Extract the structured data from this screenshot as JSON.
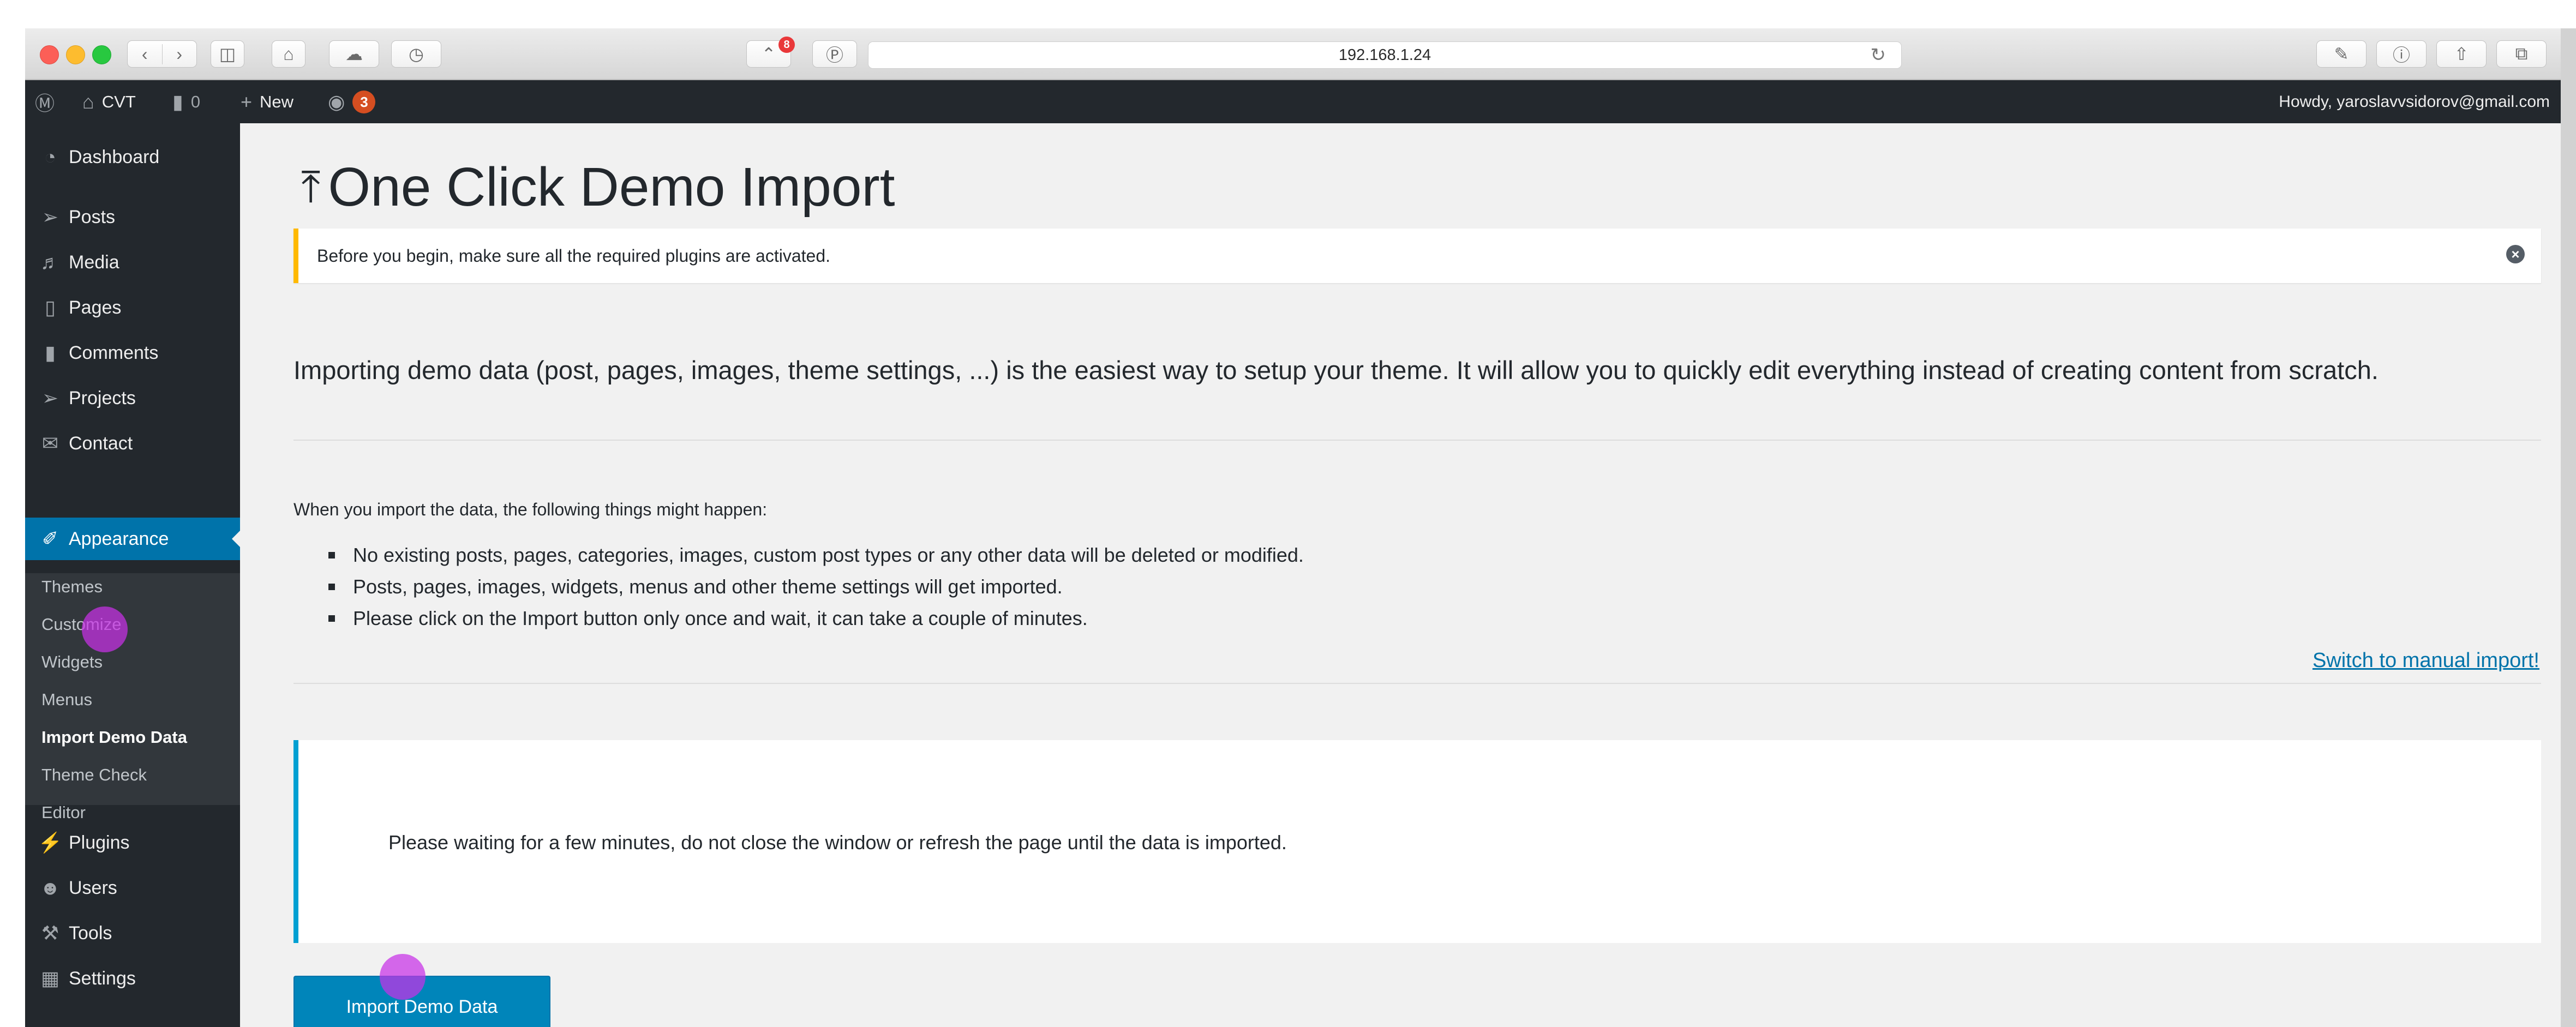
{
  "browser": {
    "url": "192.168.1.24",
    "extension_badge_count": "8"
  },
  "adminbar": {
    "wp_logo_icon": "wordpress-icon",
    "site_name": "CVT",
    "comments_count": "0",
    "new_label": "New",
    "yoast_count": "3",
    "howdy": "Howdy, yaroslavvsidorov@gmail.com"
  },
  "sidebar": {
    "items": [
      {
        "label": "Dashboard",
        "icon": "dashboard-icon"
      },
      {
        "label": "Posts",
        "icon": "pin-icon"
      },
      {
        "label": "Media",
        "icon": "media-icon"
      },
      {
        "label": "Pages",
        "icon": "pages-icon"
      },
      {
        "label": "Comments",
        "icon": "comment-icon"
      },
      {
        "label": "Projects",
        "icon": "pin-icon"
      },
      {
        "label": "Contact",
        "icon": "mail-icon"
      },
      {
        "label": "Appearance",
        "icon": "brush-icon"
      }
    ],
    "submenu": [
      "Themes",
      "Customize",
      "Widgets",
      "Menus",
      "Import Demo Data",
      "Theme Check",
      "Editor"
    ],
    "lower_items": [
      {
        "label": "Plugins",
        "icon": "plugin-icon"
      },
      {
        "label": "Users",
        "icon": "user-icon"
      },
      {
        "label": "Tools",
        "icon": "wrench-icon"
      },
      {
        "label": "Settings",
        "icon": "settings-icon"
      }
    ]
  },
  "main": {
    "title": "One Click Demo Import",
    "notice": "Before you begin, make sure all the required plugins are activated.",
    "intro": "Importing demo data (post, pages, images, theme settings, ...) is the easiest way to setup your theme. It will allow you to quickly edit everything instead of creating content from scratch.",
    "happen_label": "When you import the data, the following things might happen:",
    "bullets": [
      "No existing posts, pages, categories, images, custom post types or any other data will be deleted or modified.",
      "Posts, pages, images, widgets, menus and other theme settings will get imported.",
      "Please click on the Import button only once and wait, it can take a couple of minutes."
    ],
    "manual_link": "Switch to manual import!",
    "waiting_text": "Please waiting for a few minutes, do not close the window or refresh the page until the data is imported.",
    "import_button": "Import Demo Data"
  },
  "colors": {
    "admin_dark": "#23282d",
    "accent_blue": "#0073aa",
    "notice_warning": "#ffb900",
    "info_border": "#00a0d2",
    "cursor_highlight": "#c731e8"
  }
}
